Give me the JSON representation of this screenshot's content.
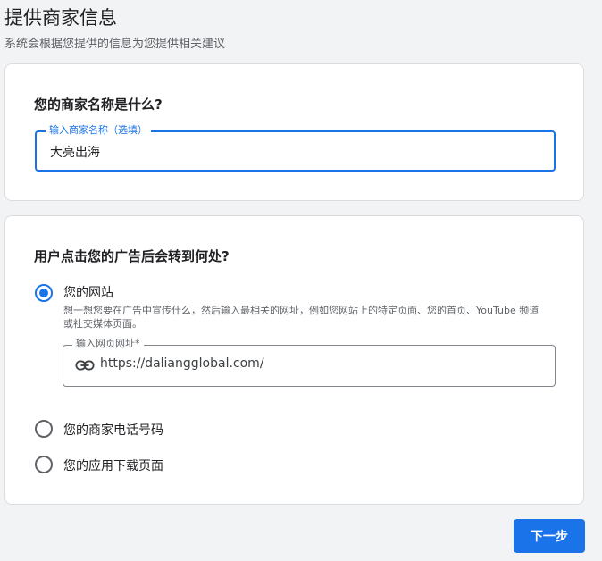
{
  "header": {
    "title": "提供商家信息",
    "subtitle": "系统会根据您提供的信息为您提供相关建议"
  },
  "business_name_card": {
    "question": "您的商家名称是什么?",
    "field_label": "输入商家名称（选填）",
    "field_value": "大亮出海"
  },
  "destination_card": {
    "question": "用户点击您的广告后会转到何处?",
    "options": [
      {
        "label": "您的网站",
        "selected": true,
        "description": "想一想您要在广告中宣传什么，然后输入最相关的网址，例如您网站上的特定页面、您的首页、YouTube 频道或社交媒体页面。",
        "url_field_label": "输入网页网址*",
        "url_field_value": "https://daliangglobal.com/",
        "url_icon": "link-icon"
      },
      {
        "label": "您的商家电话号码",
        "selected": false
      },
      {
        "label": "您的应用下载页面",
        "selected": false
      }
    ]
  },
  "footer": {
    "next_button_label": "下一步"
  },
  "colors": {
    "accent": "#1a73e8",
    "background": "#f1f3f4",
    "card": "#ffffff"
  }
}
